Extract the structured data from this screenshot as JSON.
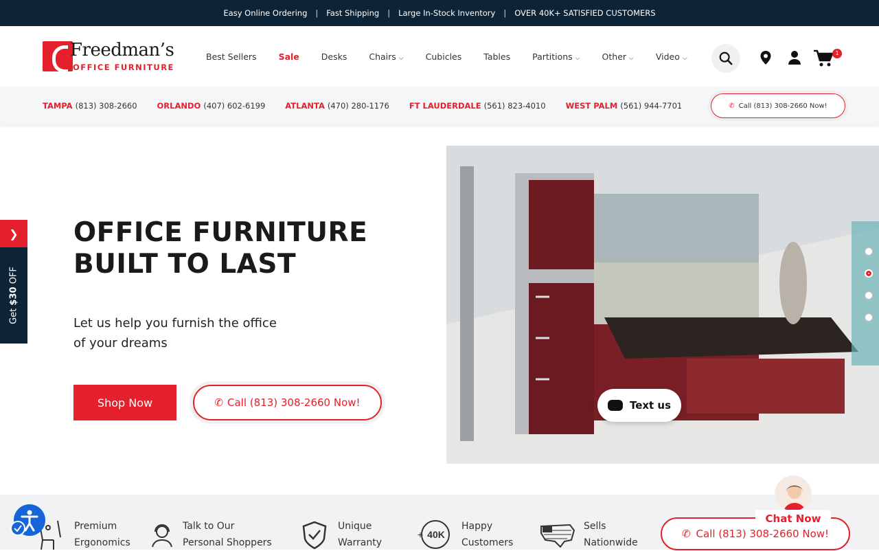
{
  "topbar": {
    "items": [
      "Easy Online Ordering",
      "Fast Shipping",
      "Large In-Stock Inventory",
      "OVER 40K+ SATISFIED CUSTOMERS"
    ],
    "separator": "|"
  },
  "logo": {
    "name": "Freedman’s",
    "sub": "OFFICE FURNITURE"
  },
  "nav": {
    "items": [
      {
        "label": "Best Sellers",
        "dropdown": false
      },
      {
        "label": "Sale",
        "dropdown": false
      },
      {
        "label": "Desks",
        "dropdown": false
      },
      {
        "label": "Chairs",
        "dropdown": true
      },
      {
        "label": "Cubicles",
        "dropdown": false
      },
      {
        "label": "Tables",
        "dropdown": false
      },
      {
        "label": "Partitions",
        "dropdown": true
      },
      {
        "label": "Other",
        "dropdown": true
      },
      {
        "label": "Video",
        "dropdown": true
      }
    ],
    "cart_count": "1"
  },
  "locations": [
    {
      "city": "TAMPA",
      "phone": "(813) 308-2660"
    },
    {
      "city": "ORLANDO",
      "phone": "(407) 602-6199"
    },
    {
      "city": "ATLANTA",
      "phone": "(470) 280-1176"
    },
    {
      "city": "FT LAUDERDALE",
      "phone": "(561) 823-4010"
    },
    {
      "city": "WEST PALM",
      "phone": "(561) 944-7701"
    }
  ],
  "header_call": "Call (813) 308-2660 Now!",
  "hero": {
    "title_line1": "OFFICE FURNITURE",
    "title_line2": "BUILT TO LAST",
    "subtitle": "Let us help you furnish the office of your dreams",
    "shop_label": "Shop Now",
    "call_label": "Call (813) 308-2660 Now!",
    "slides": 4,
    "active_slide": 2
  },
  "side_tab": {
    "prefix": "Get ",
    "amount": "$30",
    "suffix": " OFF"
  },
  "text_us": "Text us",
  "features": [
    {
      "line1": "Premium",
      "line2": "Ergonomics",
      "icon": "ergonomic-chair-icon"
    },
    {
      "line1": "Talk to Our",
      "line2": "Personal Shoppers",
      "icon": "headset-person-icon"
    },
    {
      "line1": "Unique",
      "line2": "Warranty",
      "icon": "shield-check-icon"
    },
    {
      "line1": "Happy",
      "line2": "Customers",
      "icon": "40k-badge-icon"
    },
    {
      "line1": "Sells",
      "line2": "Nationwide",
      "icon": "usa-flag-map-icon"
    }
  ],
  "badge_40k": "40K",
  "bottom_call": "Call (813) 308-2660 Now!",
  "chat_now": "Chat Now",
  "colors": {
    "brand_red": "#e3202c",
    "navy": "#0d2436",
    "accessibility_blue": "#1565d8"
  }
}
